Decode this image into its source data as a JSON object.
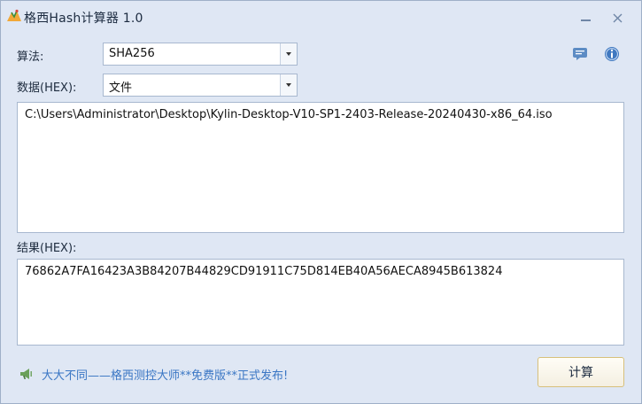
{
  "window": {
    "title": "格西Hash计算器 1.0",
    "icons": {
      "app": "app-logo-icon",
      "minimize": "minimize-icon",
      "close": "close-icon"
    }
  },
  "algorithm": {
    "label": "算法:",
    "selected": "SHA256"
  },
  "data_source": {
    "label": "数据(HEX):",
    "selected": "文件"
  },
  "toolbar_icons": {
    "comment": "comment-icon",
    "info": "info-icon"
  },
  "input": {
    "value": "C:\\Users\\Administrator\\Desktop\\Kylin-Desktop-V10-SP1-2403-Release-20240430-x86_64.iso"
  },
  "result": {
    "label": "结果(HEX):",
    "value": "76862A7FA16423A3B84207B44829CD91911C75D814EB40A56AECA8945B613824"
  },
  "promo": {
    "icon": "megaphone-icon",
    "text": "大大不同——格西测控大师**免费版**正式发布!"
  },
  "actions": {
    "calculate_label": "计算"
  },
  "colors": {
    "window_bg": "#dfe7f4",
    "border": "#a8b8cf",
    "link": "#3a76c4",
    "button_border": "#d7c07b"
  }
}
